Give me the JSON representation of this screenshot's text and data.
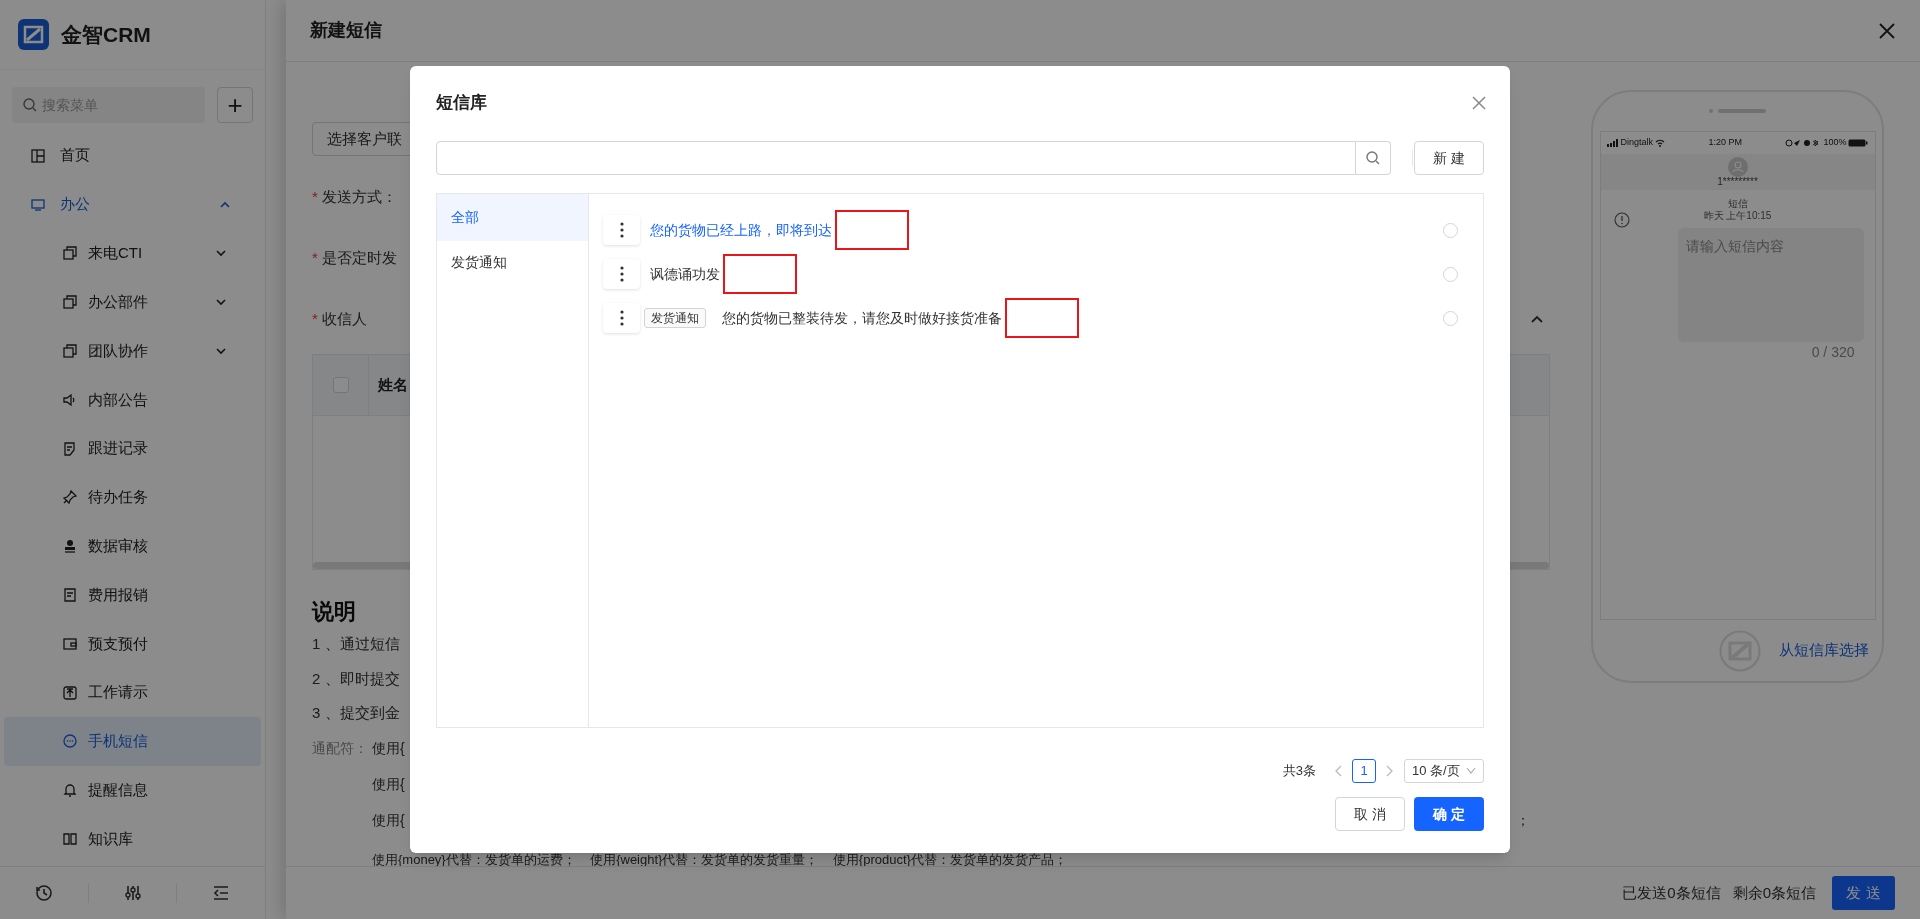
{
  "sidebar": {
    "logo_text": "金智CRM",
    "search_placeholder": "搜索菜单",
    "add_button": "+",
    "items": [
      {
        "label": "首页",
        "active": false
      },
      {
        "label": "办公",
        "active": true,
        "expanded": true,
        "children": [
          {
            "label": "来电CTI",
            "selected": false,
            "expanded": false
          },
          {
            "label": "办公部件",
            "selected": false,
            "expanded": false
          },
          {
            "label": "团队协作",
            "selected": false,
            "expanded": false
          },
          {
            "label": "内部公告",
            "selected": false
          },
          {
            "label": "跟进记录",
            "selected": false
          },
          {
            "label": "待办任务",
            "selected": false
          },
          {
            "label": "数据审核",
            "selected": false
          },
          {
            "label": "费用报销",
            "selected": false
          },
          {
            "label": "预支预付",
            "selected": false
          },
          {
            "label": "工作请示",
            "selected": false
          },
          {
            "label": "手机短信",
            "selected": true
          },
          {
            "label": "提醒信息",
            "selected": false
          },
          {
            "label": "知识库",
            "selected": false
          }
        ]
      }
    ]
  },
  "drawer": {
    "title": "新建短信",
    "contact_button": "选择客户联",
    "required_mark": "*",
    "fields": [
      {
        "label": "发送方式：",
        "required": true
      },
      {
        "label": "是否定时发",
        "required": true
      },
      {
        "label": "收信人",
        "required": true
      }
    ],
    "recipients_table": {
      "select_all_checked": false,
      "columns": [
        "姓名"
      ]
    },
    "notes": {
      "title": "说明",
      "lines": [
        "1 、通过短信",
        "2 、即时提交",
        "3 、提交到金"
      ],
      "wildcard_label": "通配符：",
      "wildcard_lines": [
        {
          "left": "使用{"
        },
        {
          "left": "使用{"
        },
        {
          "left": "使用{",
          "right": "；"
        },
        {
          "left": "使用{money}代替：发货单的运费；    使用{weight}代替：发货单的发货重量；    使用{product}代替：发货单的发货产品；"
        }
      ]
    },
    "phone": {
      "carrier": "Dingtalk",
      "time": "1:20 PM",
      "battery": "100%",
      "contact": "1*********",
      "thread_title": "短信",
      "thread_time": "昨天 上午10:15",
      "placeholder": "请输入短信内容",
      "counter": "0 / 320",
      "library_link": "从短信库选择"
    },
    "footer": {
      "sent": "已发送0条短信",
      "remaining": "剩余0条短信",
      "send_button": "发 送"
    }
  },
  "modal": {
    "title": "短信库",
    "new_button": "新 建",
    "categories": [
      {
        "label": "全部",
        "selected": true
      },
      {
        "label": "发货通知",
        "selected": false
      }
    ],
    "messages": [
      {
        "text": "您的货物已经上路，即将到达",
        "highlighted": true,
        "selected": false,
        "redacted": true
      },
      {
        "text": "讽德诵功发",
        "highlighted": false,
        "selected": false,
        "redacted": true
      },
      {
        "tag": "发货通知",
        "text": "您的货物已整装待发，请您及时做好接货准备",
        "highlighted": false,
        "selected": false,
        "redacted": true
      }
    ],
    "pagination": {
      "total": "共3条",
      "pages": [
        {
          "label": "1",
          "selected": true
        }
      ],
      "page_size": "10 条/页"
    },
    "cancel_button": "取 消",
    "ok_button": "确 定"
  }
}
